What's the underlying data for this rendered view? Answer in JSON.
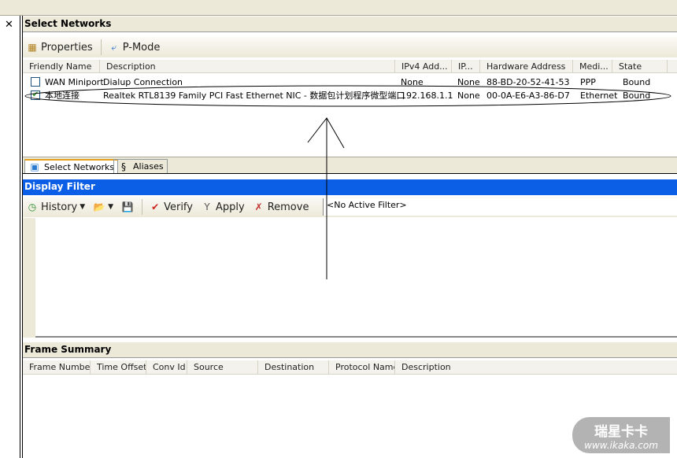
{
  "select_networks": {
    "title": "Select Networks",
    "toolbar": {
      "properties": "Properties",
      "pmode": "P-Mode"
    },
    "columns": [
      "Friendly Name",
      "Description",
      "IPv4 Add...",
      "IP...",
      "Hardware Address",
      "Medi...",
      "State"
    ],
    "rows": [
      {
        "checked": false,
        "name": "WAN Miniport",
        "description": "Dialup Connection",
        "ipv4": "None",
        "ip": "None",
        "hw": "88-BD-20-52-41-53",
        "media": "PPP",
        "state": "Bound"
      },
      {
        "checked": true,
        "name": "本地连接",
        "description": "Realtek RTL8139 Family PCI Fast Ethernet NIC - 数据包计划程序微型端口",
        "ipv4": "192.168.1.1",
        "ip": "None",
        "hw": "00-0A-E6-A3-86-D7",
        "media": "Ethernet",
        "state": "Bound"
      }
    ],
    "tabs": [
      "Select Networks",
      "Aliases"
    ]
  },
  "display_filter": {
    "title": "Display Filter",
    "history": "History",
    "verify": "Verify",
    "apply": "Apply",
    "remove": "Remove",
    "filter_text": "<No Active Filter>"
  },
  "frame_summary": {
    "title": "Frame Summary",
    "columns": [
      "Frame Number",
      "Time Offset",
      "Conv Id",
      "Source",
      "Destination",
      "Protocol Name",
      "Description"
    ]
  },
  "watermark": {
    "brand": "瑞星卡卡",
    "url": "www.ikaka.com"
  }
}
